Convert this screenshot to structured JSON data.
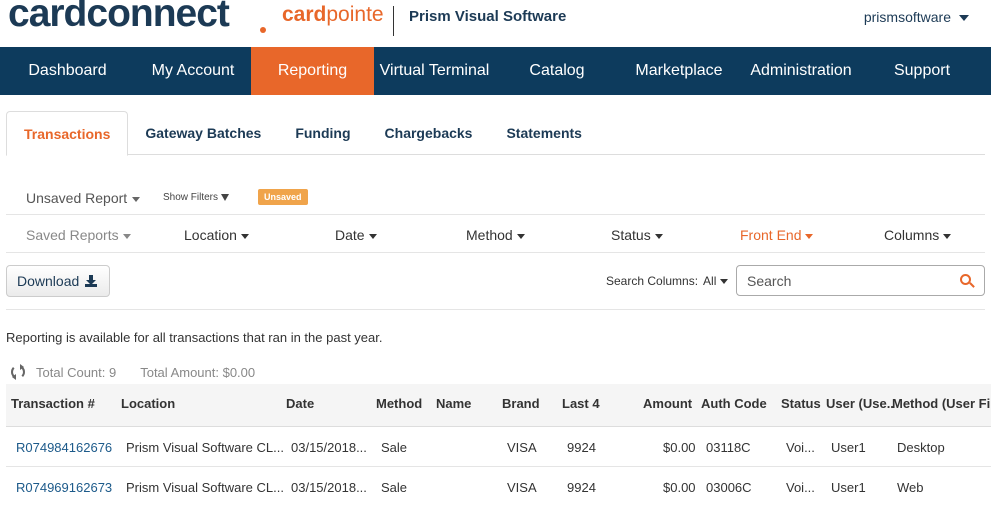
{
  "header": {
    "logo_main": "cardconnect",
    "logo_sub_a": "card",
    "logo_sub_b": "pointe",
    "company": "Prism Visual Software",
    "user": "prismsoftware"
  },
  "colors": {
    "nav_bg": "#0d3b5d",
    "accent": "#e8672a",
    "brand_text": "#1c3a55",
    "badge": "#f0a44b"
  },
  "nav": [
    {
      "label": "Dashboard",
      "active": false
    },
    {
      "label": "My Account",
      "active": false
    },
    {
      "label": "Reporting",
      "active": true
    },
    {
      "label": "Virtual Terminal",
      "active": false
    },
    {
      "label": "Catalog",
      "active": false
    },
    {
      "label": "Marketplace",
      "active": false
    },
    {
      "label": "Administration",
      "active": false
    },
    {
      "label": "Support",
      "active": false
    }
  ],
  "tabs": [
    {
      "label": "Transactions",
      "active": true
    },
    {
      "label": "Gateway Batches",
      "active": false
    },
    {
      "label": "Funding",
      "active": false
    },
    {
      "label": "Chargebacks",
      "active": false
    },
    {
      "label": "Statements",
      "active": false
    }
  ],
  "report": {
    "current": "Unsaved Report",
    "show_filters": "Show Filters",
    "badge": "Unsaved"
  },
  "filters": {
    "saved_reports": "Saved Reports",
    "location": "Location",
    "date": "Date",
    "method": "Method",
    "status": "Status",
    "front_end": "Front End",
    "columns": "Columns"
  },
  "actions": {
    "download": "Download",
    "search_columns_label": "Search Columns:",
    "search_columns_value": "All",
    "search_placeholder": "Search"
  },
  "notice": "Reporting is available for all transactions that ran in the past year.",
  "totals": {
    "count": "Total Count: 9",
    "amount": "Total Amount: $0.00"
  },
  "table": {
    "headers": {
      "transaction": "Transaction #",
      "location": "Location",
      "date": "Date",
      "method": "Method",
      "name": "Name",
      "brand": "Brand",
      "last4": "Last 4",
      "amount": "Amount",
      "auth": "Auth Code",
      "status": "Status",
      "user": "User (Use..",
      "method_user": "Method (User Fi"
    },
    "rows": [
      {
        "transaction": "R074984162676",
        "location": "Prism Visual Software CL...",
        "date": "03/15/2018...",
        "method": "Sale",
        "name": "",
        "brand": "VISA",
        "last4": "9924",
        "amount": "$0.00",
        "auth": "03118C",
        "status": "Voi...",
        "user": "User1",
        "method_user": "Desktop"
      },
      {
        "transaction": "R074969162673",
        "location": "Prism Visual Software CL...",
        "date": "03/15/2018...",
        "method": "Sale",
        "name": "",
        "brand": "VISA",
        "last4": "9924",
        "amount": "$0.00",
        "auth": "03006C",
        "status": "Voi...",
        "user": "User1",
        "method_user": "Web"
      }
    ]
  }
}
